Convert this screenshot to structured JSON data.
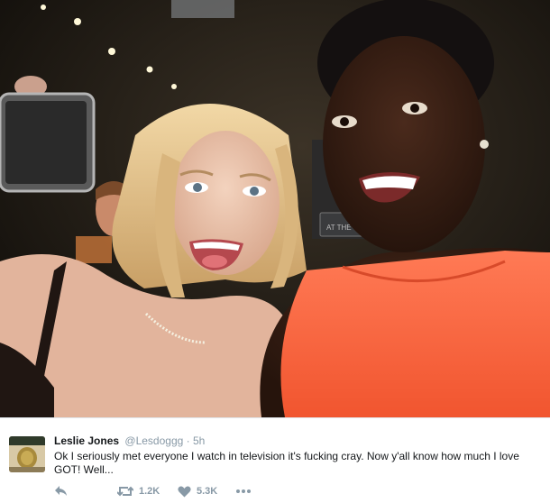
{
  "tweet": {
    "display_name": "Leslie Jones",
    "handle": "@Lesdoggg",
    "separator": "·",
    "time": "5h",
    "text": "Ok I seriously met everyone I watch in television it's fucking cray. Now y'all know how much I love GOT! Well...",
    "avatar_icon": "profile-avatar",
    "actions": {
      "reply_icon": "reply-icon",
      "retweet_icon": "retweet-icon",
      "retweet_count": "1.2K",
      "like_icon": "heart-icon",
      "like_count": "5.3K",
      "more_icon": "more-icon"
    }
  },
  "photo": {
    "sign_text": "AT THE",
    "colors": {
      "dress": "#ff6a47",
      "hair_blonde": "#e6c48c",
      "background": "#1b1712"
    }
  },
  "colors": {
    "muted": "#8899a6",
    "text": "#14171a",
    "border": "#e1e8ed"
  }
}
